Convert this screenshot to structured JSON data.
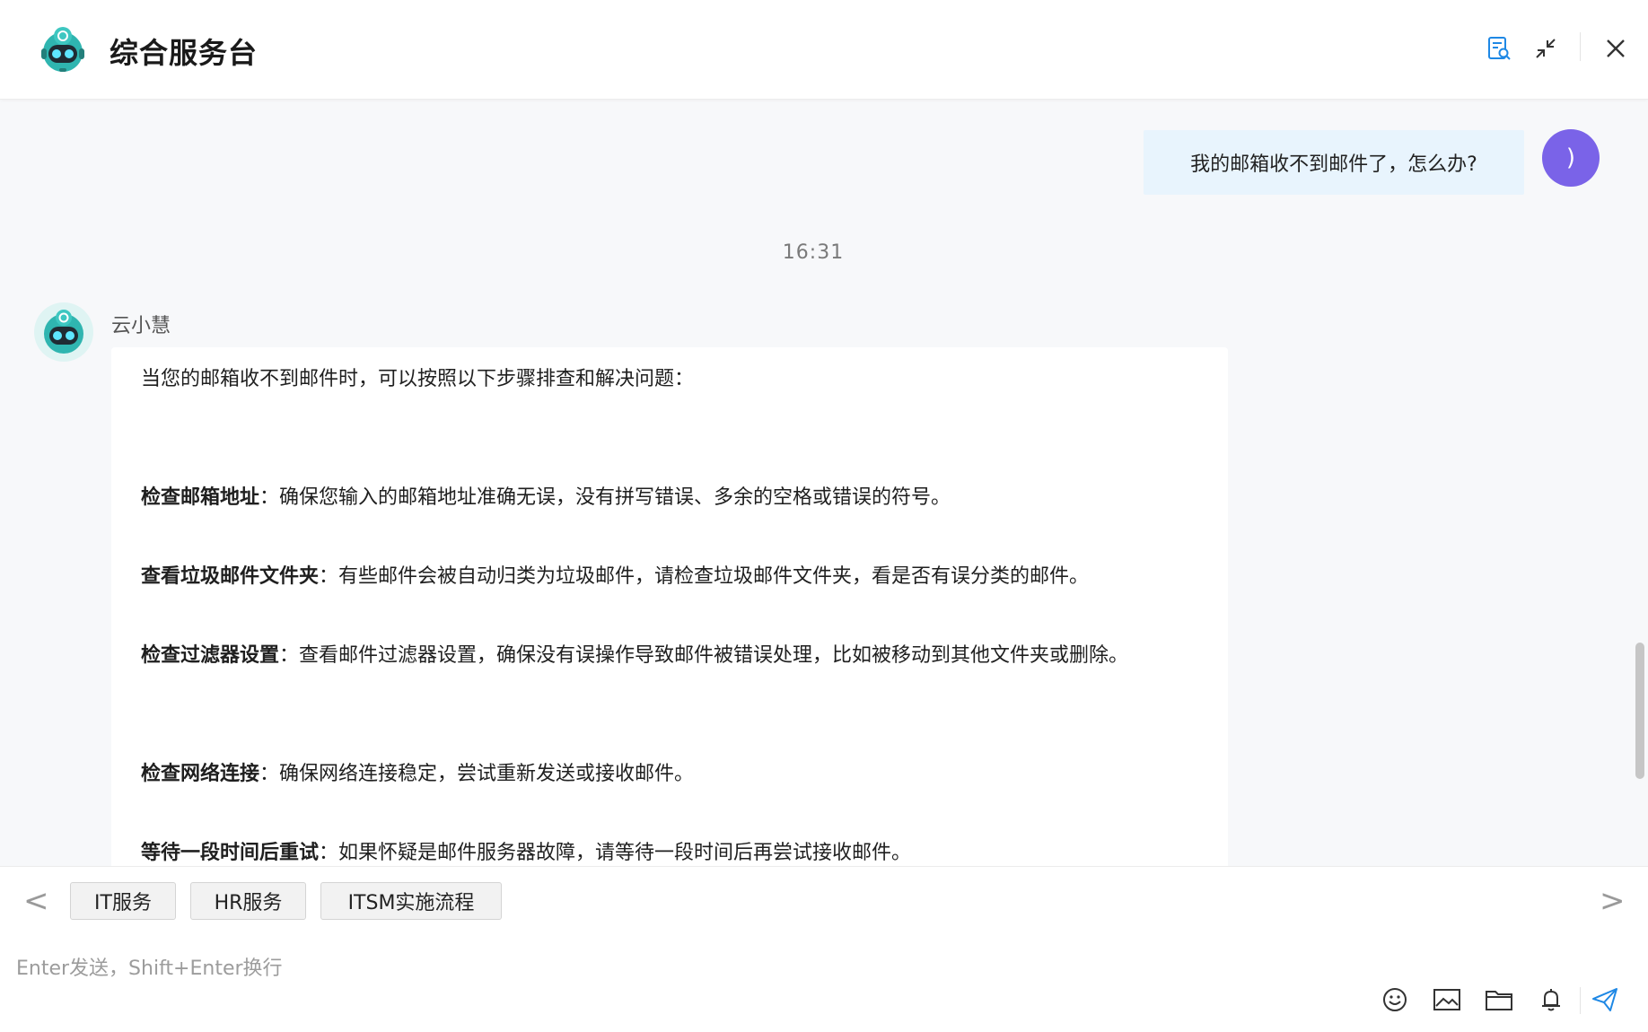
{
  "header": {
    "title": "综合服务台"
  },
  "chat": {
    "user_message": "我的邮箱收不到邮件了，怎么办?",
    "user_avatar_text": ")",
    "timestamp": "16:31",
    "bot_name": "云小慧",
    "bot_reply": {
      "intro": "当您的邮箱收不到邮件时，可以按照以下步骤排查和解决问题：",
      "steps": [
        {
          "title": "检查邮箱地址",
          "text": "：确保您输入的邮箱地址准确无误，没有拼写错误、多余的空格或错误的符号。"
        },
        {
          "title": "查看垃圾邮件文件夹",
          "text": "：有些邮件会被自动归类为垃圾邮件，请检查垃圾邮件文件夹，看是否有误分类的邮件。"
        },
        {
          "title": "检查过滤器设置",
          "text": "：查看邮件过滤器设置，确保没有误操作导致邮件被错误处理，比如被移动到其他文件夹或删除。"
        },
        {
          "title": "检查网络连接",
          "text": "：确保网络连接稳定，尝试重新发送或接收邮件。"
        },
        {
          "title": "等待一段时间后重试",
          "text": "：如果怀疑是邮件服务器故障，请等待一段时间后再尝试接收邮件。"
        }
      ]
    }
  },
  "quick_tags": {
    "prev": "<",
    "next": ">",
    "items": [
      "IT服务",
      "HR服务",
      "ITSM实施流程"
    ]
  },
  "input": {
    "placeholder": "Enter发送，Shift+Enter换行"
  },
  "icons": {
    "header": [
      "search-document-icon",
      "minimize-icon",
      "close-icon"
    ],
    "toolbar": [
      "emoji-icon",
      "image-icon",
      "folder-icon",
      "bell-icon",
      "send-icon"
    ],
    "accent": "#1e88e5",
    "user_avatar_color": "#7a63e8",
    "bot_teal": "#2fb5b0"
  }
}
